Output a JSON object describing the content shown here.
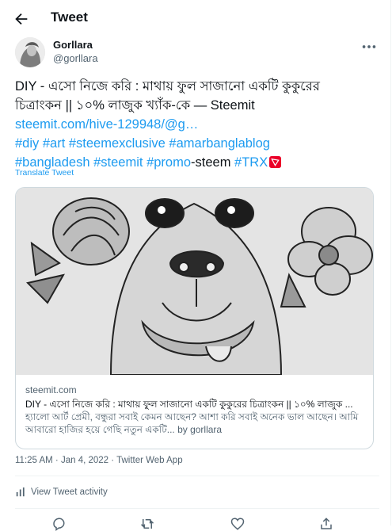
{
  "header": {
    "title": "Tweet"
  },
  "user": {
    "name": "Gorllara",
    "handle": "@gorllara"
  },
  "tweet": {
    "line1": "DIY - এসো নিজে করি : মাথায় ফুল সাজানো একটি কুকুরের",
    "line2": "চিত্রাংকন || ১০% লাজুক খ্যাঁক-কে — Steemit",
    "link": "steemit.com/hive-129948/@g…",
    "tags_line1": "#diy #art #steemexclusive #amarbanglablog",
    "tag_bangladesh": "#bangladesh",
    "tag_steemit": "#steemit",
    "tag_promo": "#promo",
    "promo_suffix": "-steem",
    "tag_trx": "#TRX"
  },
  "translate": "Translate Tweet",
  "card": {
    "domain": "steemit.com",
    "title": "DIY - এসো নিজে করি : মাথায় ফুল সাজানো একটি কুকুরের চিত্রাংকন || ১০% লাজুক ...",
    "description": "হ্যালো আর্ট প্রেমী, বন্ধুরা সবাই কেমন আছেন? আশা করি সবাই অনেক ভাল আছেন। আমি আবারো হাজির হয়ে গেছি নতুন একটি... by gorllara"
  },
  "meta": "11:25 AM · Jan 4, 2022 · Twitter Web App",
  "activity": "View Tweet activity",
  "colors": {
    "accent": "#1d9bf0",
    "text": "#0f1419",
    "muted": "#536471",
    "trx": "#eb0029"
  },
  "icons": [
    "back-arrow-icon",
    "more-icon",
    "tron-icon",
    "analytics-icon",
    "reply-icon",
    "retweet-icon",
    "like-icon",
    "share-icon"
  ]
}
